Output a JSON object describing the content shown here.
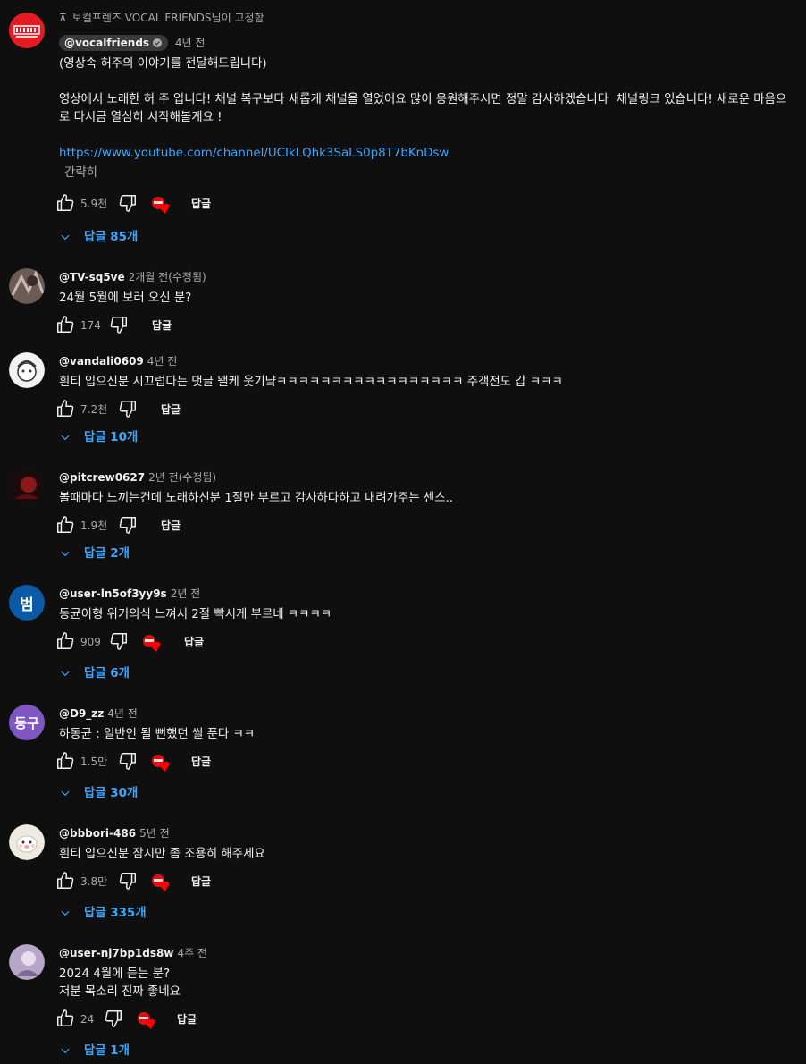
{
  "pinned_label": "보컬프렌즈 VOCAL FRIENDS님이 고정함",
  "colors": {
    "link": "#3ea6ff",
    "bg": "#0f0f0f",
    "heart": "#ff0000"
  },
  "comments": [
    {
      "author": "@vocalfriends",
      "time": "4년 전",
      "text": "(영상속 허주의 이야기를 전달해드립니다)\n\n영상에서 노래한 허 주 입니다! 채널 복구보다 새롭게 채널을 열었어요 많이 응원해주시면 정말 감사하겠습니다  채널링크 있습니다! 새로운 마음으로 다시금 열심히 시작해볼게요 !",
      "link": "https://www.youtube.com/channel/UCIkLQhk3SaLS0p8T7bKnDsw",
      "read_more": "간략히",
      "likes": "5.9천",
      "reply_label": "답글",
      "replies": "답글 85개"
    },
    {
      "author": "@TV-sq5ve",
      "time": "2개월 전(수정됨)",
      "text": "24월 5월에 보러 오신 분?",
      "likes": "174",
      "reply_label": "답글"
    },
    {
      "author": "@vandali0609",
      "time": "4년 전",
      "text": "흰티 입으신분 시끄럽다는 댓글 왤케 웃기냨ㅋㅋㅋㅋㅋㅋㅋㅋㅋㅋㅋㅋㅋㅋㅋㅋㅋ 주객전도 갑 ㅋㅋㅋ",
      "likes": "7.2천",
      "reply_label": "답글",
      "replies": "답글 10개"
    },
    {
      "author": "@pitcrew0627",
      "time": "2년 전(수정됨)",
      "text": "볼때마다 느끼는건데 노래하신분 1절만 부르고 감사하다하고 내려가주는 센스..",
      "likes": "1.9천",
      "reply_label": "답글",
      "replies": "답글 2개"
    },
    {
      "author": "@user-ln5of3yy9s",
      "time": "2년 전",
      "avatar_letter": "범",
      "text": "동균이형 위기의식 느껴서 2절 빡시게 부르네 ㅋㅋㅋㅋ",
      "likes": "909",
      "reply_label": "답글",
      "replies": "답글 6개"
    },
    {
      "author": "@D9_zz",
      "time": "4년 전",
      "avatar_letter": "동구",
      "text": "하동균 : 일반인 될 뻔했던 썰 푼다 ㅋㅋ",
      "likes": "1.5만",
      "reply_label": "답글",
      "replies": "답글 30개"
    },
    {
      "author": "@bbbori-486",
      "time": "5년 전",
      "text": "흰티 입으신분 잠시만 좀 조용히 해주세요",
      "likes": "3.8만",
      "reply_label": "답글",
      "replies": "답글 335개"
    },
    {
      "author": "@user-nj7bp1ds8w",
      "time": "4주 전",
      "text": "2024 4월에 듣는 분?\n저분 목소리 진짜 좋네요",
      "likes": "24",
      "reply_label": "답글",
      "replies": "답글 1개"
    }
  ]
}
